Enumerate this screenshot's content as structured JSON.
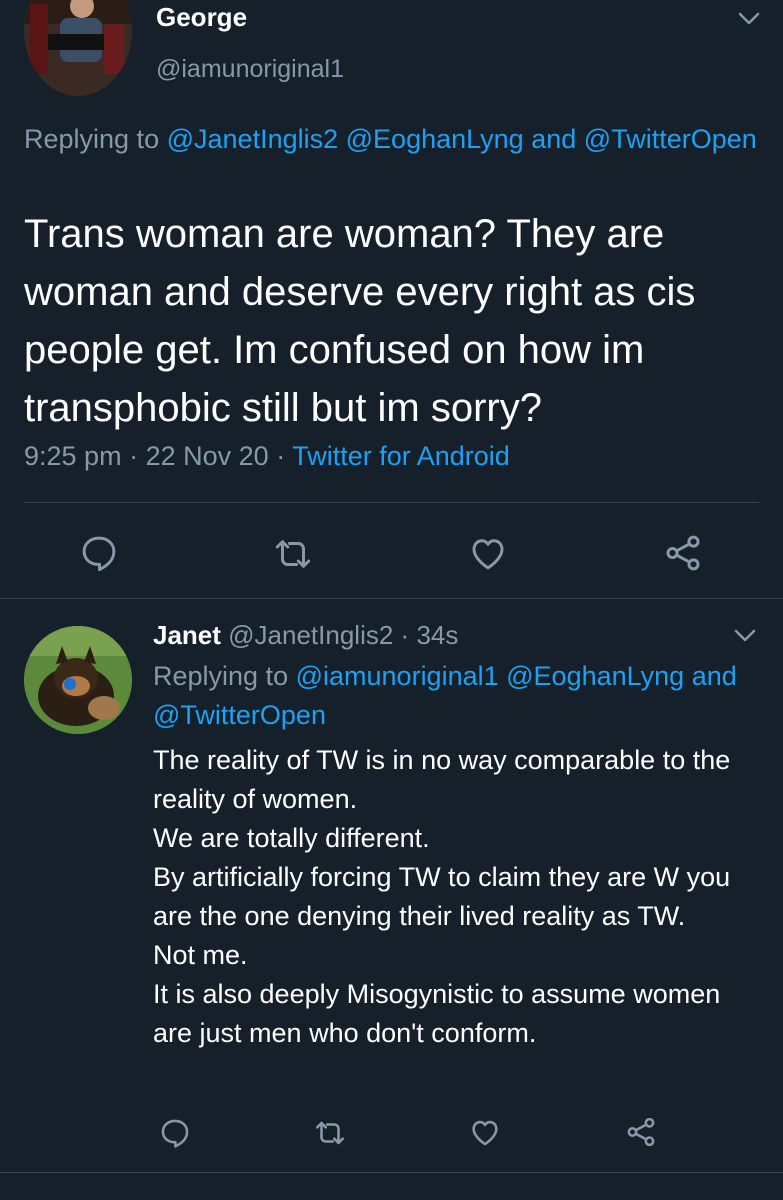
{
  "main_tweet": {
    "author_name": "George",
    "author_handle": "@iamunoriginal1",
    "replying_prefix": "Replying to",
    "replying_mention_1": "@JanetInglis2",
    "replying_mention_2": "@EoghanLyng",
    "replying_and": "and",
    "replying_mention_3": "@TwitterOpen",
    "text": "Trans woman are woman? They are woman and deserve every right as cis people get. Im confused on how im transphobic still but im sorry?",
    "time": "9:25 pm",
    "date": "22 Nov 20",
    "source": "Twitter for Android",
    "dot": "·"
  },
  "reply_tweet": {
    "author_name": "Janet",
    "author_handle": "@JanetInglis2",
    "age": "34s",
    "dot": "·",
    "replying_prefix": "Replying to",
    "replying_mention_1": "@iamunoriginal1",
    "replying_mention_2": "@EoghanLyng",
    "replying_and": "and",
    "replying_mention_3": "@TwitterOpen",
    "lines": [
      "The reality of TW is in no way comparable to the reality of women.",
      "We are totally different.",
      "By artificially forcing TW to claim they are W you are the one denying their lived reality as TW.",
      "Not me.",
      "It is also deeply Misogynistic to assume women are just men who don't conform."
    ]
  },
  "icons": [
    "chevron-down-icon",
    "reply-icon",
    "retweet-icon",
    "like-icon",
    "share-icon"
  ],
  "colors": {
    "background": "#15202b",
    "link": "#1da1f2",
    "muted": "#8899a6",
    "divider": "#38444d"
  }
}
